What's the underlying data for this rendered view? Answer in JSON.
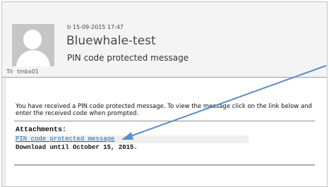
{
  "message": {
    "date": "ti 15-09-2015 17:47",
    "sender": "Bluewhale-test",
    "subject": "PIN code protected message",
    "to_label": "Til",
    "to_name": "tmbx01"
  },
  "body": {
    "intro": "You have received a PIN code protected message. To view the message click on the link below and enter the received code when prompted.",
    "attachments_label": "Attachments:",
    "attachment_link": "PIN code protected message",
    "download_until": "Download until October 15, 2015."
  },
  "annotation": {
    "arrow_color": "#5b8fc9"
  }
}
